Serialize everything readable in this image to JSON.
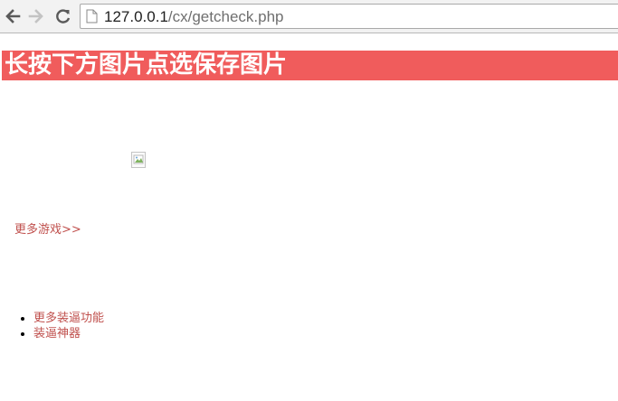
{
  "browser": {
    "url_host": "127.0.0.1",
    "url_path": "/cx/getcheck.php",
    "icons": [
      "back-arrow-icon",
      "forward-arrow-icon",
      "reload-icon",
      "page-icon"
    ]
  },
  "page": {
    "banner_title": "长按下方图片点选保存图片",
    "banner_color": "#f05c5c",
    "more_games_label": "更多游戏>>",
    "list_items": [
      "更多装逼功能",
      "装逼神器"
    ],
    "link_color": "#c0504d"
  }
}
